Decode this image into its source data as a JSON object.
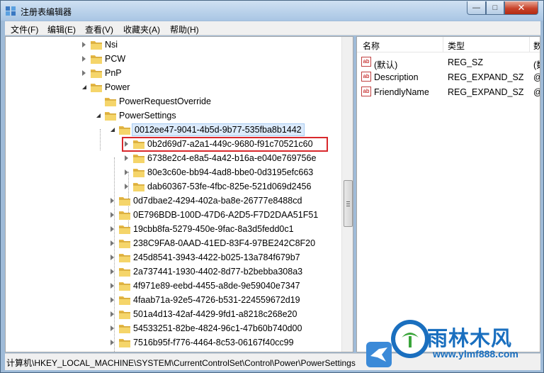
{
  "window": {
    "title": "注册表编辑器",
    "close_glyph": "✕",
    "max_glyph": "□",
    "min_glyph": "—"
  },
  "menu": [
    "文件(F)",
    "编辑(E)",
    "查看(V)",
    "收藏夹(A)",
    "帮助(H)"
  ],
  "tree": {
    "items": [
      {
        "label": "Nsi",
        "depth": 0,
        "state": "collapsed"
      },
      {
        "label": "PCW",
        "depth": 0,
        "state": "collapsed"
      },
      {
        "label": "PnP",
        "depth": 0,
        "state": "collapsed"
      },
      {
        "label": "Power",
        "depth": 0,
        "state": "expanded"
      },
      {
        "label": "PowerRequestOverride",
        "depth": 1,
        "state": "leaf"
      },
      {
        "label": "PowerSettings",
        "depth": 1,
        "state": "expanded"
      },
      {
        "label": "0012ee47-9041-4b5d-9b77-535fba8b1442",
        "depth": 2,
        "state": "expanded",
        "selected": true
      },
      {
        "label": "0b2d69d7-a2a1-449c-9680-f91c70521c60",
        "depth": 3,
        "state": "collapsed",
        "highlighted": true
      },
      {
        "label": "6738e2c4-e8a5-4a42-b16a-e040e769756e",
        "depth": 3,
        "state": "collapsed"
      },
      {
        "label": "80e3c60e-bb94-4ad8-bbe0-0d3195efc663",
        "depth": 3,
        "state": "collapsed"
      },
      {
        "label": "dab60367-53fe-4fbc-825e-521d069d2456",
        "depth": 3,
        "state": "collapsed"
      },
      {
        "label": "0d7dbae2-4294-402a-ba8e-26777e8488cd",
        "depth": 2,
        "state": "collapsed"
      },
      {
        "label": "0E796BDB-100D-47D6-A2D5-F7D2DAA51F51",
        "depth": 2,
        "state": "collapsed"
      },
      {
        "label": "19cbb8fa-5279-450e-9fac-8a3d5fedd0c1",
        "depth": 2,
        "state": "collapsed"
      },
      {
        "label": "238C9FA8-0AAD-41ED-83F4-97BE242C8F20",
        "depth": 2,
        "state": "collapsed"
      },
      {
        "label": "245d8541-3943-4422-b025-13a784f679b7",
        "depth": 2,
        "state": "collapsed"
      },
      {
        "label": "2a737441-1930-4402-8d77-b2bebba308a3",
        "depth": 2,
        "state": "collapsed"
      },
      {
        "label": "4f971e89-eebd-4455-a8de-9e59040e7347",
        "depth": 2,
        "state": "collapsed"
      },
      {
        "label": "4faab71a-92e5-4726-b531-224559672d19",
        "depth": 2,
        "state": "collapsed"
      },
      {
        "label": "501a4d13-42af-4429-9fd1-a8218c268e20",
        "depth": 2,
        "state": "collapsed"
      },
      {
        "label": "54533251-82be-4824-96c1-47b60b740d00",
        "depth": 2,
        "state": "collapsed"
      },
      {
        "label": "7516b95f-f776-4464-8c53-06167f40cc99",
        "depth": 2,
        "state": "collapsed"
      }
    ]
  },
  "values": {
    "headers": {
      "name": "名称",
      "type": "类型",
      "data": "数"
    },
    "rows": [
      {
        "name": "(默认)",
        "type": "REG_SZ",
        "data": "(数"
      },
      {
        "name": "Description",
        "type": "REG_EXPAND_SZ",
        "data": "@"
      },
      {
        "name": "FriendlyName",
        "type": "REG_EXPAND_SZ",
        "data": "@"
      }
    ],
    "icon_text": "ab"
  },
  "status": {
    "path": "计算机\\HKEY_LOCAL_MACHINE\\SYSTEM\\CurrentControlSet\\Control\\Power\\PowerSettings"
  },
  "watermark": {
    "title": "雨林木风",
    "url": "www.ylmf888.com"
  },
  "colors": {
    "accent": "#1a6fbf",
    "highlight_box": "#d8282c",
    "selection": "#dbeafb"
  }
}
